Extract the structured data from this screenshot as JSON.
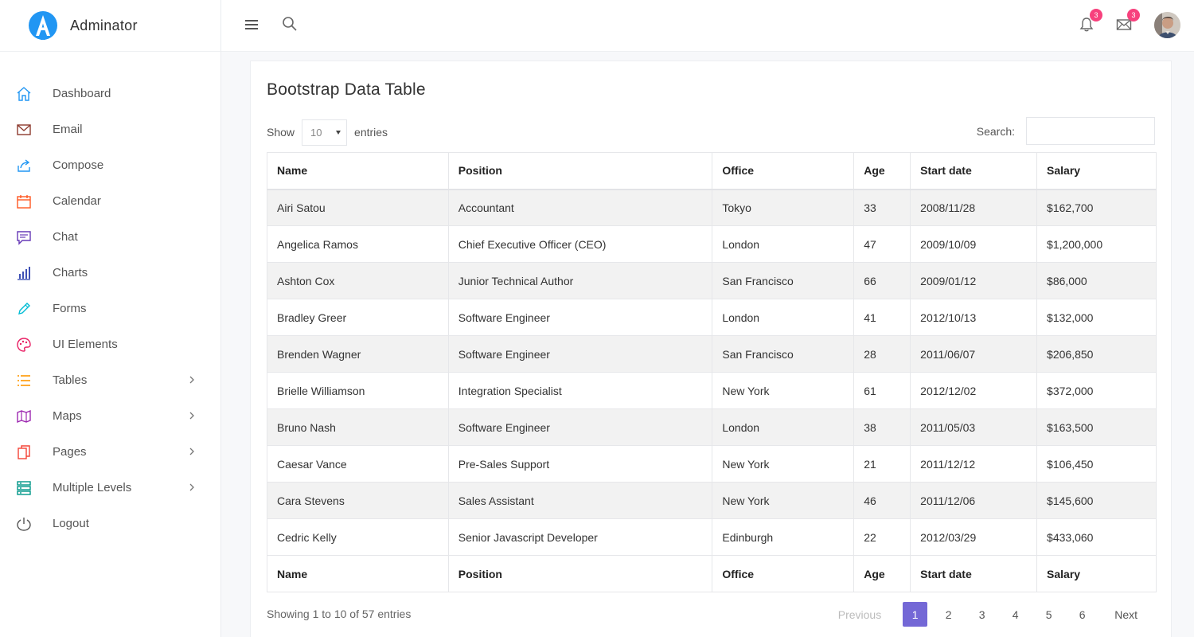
{
  "brand": {
    "name": "Adminator"
  },
  "sidebar": {
    "items": [
      {
        "label": "Dashboard",
        "icon": "home-icon",
        "color": "#2196f3",
        "chevron": false
      },
      {
        "label": "Email",
        "icon": "mail-icon",
        "color": "#8d3a2e",
        "chevron": false
      },
      {
        "label": "Compose",
        "icon": "share-icon",
        "color": "#2196f3",
        "chevron": false
      },
      {
        "label": "Calendar",
        "icon": "calendar-icon",
        "color": "#ff5722",
        "chevron": false
      },
      {
        "label": "Chat",
        "icon": "chat-icon",
        "color": "#673ab7",
        "chevron": false
      },
      {
        "label": "Charts",
        "icon": "bar-chart-icon",
        "color": "#3f51b5",
        "chevron": false
      },
      {
        "label": "Forms",
        "icon": "pencil-icon",
        "color": "#00bcd4",
        "chevron": false
      },
      {
        "label": "UI Elements",
        "icon": "palette-icon",
        "color": "#e91e63",
        "chevron": false
      },
      {
        "label": "Tables",
        "icon": "list-icon",
        "color": "#ff9800",
        "chevron": true
      },
      {
        "label": "Maps",
        "icon": "map-icon",
        "color": "#9c27b0",
        "chevron": true
      },
      {
        "label": "Pages",
        "icon": "files-icon",
        "color": "#f44336",
        "chevron": true
      },
      {
        "label": "Multiple Levels",
        "icon": "layers-icon",
        "color": "#009688",
        "chevron": true
      },
      {
        "label": "Logout",
        "icon": "power-icon",
        "color": "#555555",
        "chevron": false
      }
    ]
  },
  "header": {
    "notifications_count": "3",
    "messages_count": "3",
    "badge_color": "#f7417d"
  },
  "card": {
    "title": "Bootstrap Data Table",
    "show_label": "Show",
    "entries_value": "10",
    "entries_label": "entries",
    "search_label": "Search:",
    "search_value": ""
  },
  "table": {
    "columns": [
      "Name",
      "Position",
      "Office",
      "Age",
      "Start date",
      "Salary"
    ],
    "rows": [
      [
        "Airi Satou",
        "Accountant",
        "Tokyo",
        "33",
        "2008/11/28",
        "$162,700"
      ],
      [
        "Angelica Ramos",
        "Chief Executive Officer (CEO)",
        "London",
        "47",
        "2009/10/09",
        "$1,200,000"
      ],
      [
        "Ashton Cox",
        "Junior Technical Author",
        "San Francisco",
        "66",
        "2009/01/12",
        "$86,000"
      ],
      [
        "Bradley Greer",
        "Software Engineer",
        "London",
        "41",
        "2012/10/13",
        "$132,000"
      ],
      [
        "Brenden Wagner",
        "Software Engineer",
        "San Francisco",
        "28",
        "2011/06/07",
        "$206,850"
      ],
      [
        "Brielle Williamson",
        "Integration Specialist",
        "New York",
        "61",
        "2012/12/02",
        "$372,000"
      ],
      [
        "Bruno Nash",
        "Software Engineer",
        "London",
        "38",
        "2011/05/03",
        "$163,500"
      ],
      [
        "Caesar Vance",
        "Pre-Sales Support",
        "New York",
        "21",
        "2011/12/12",
        "$106,450"
      ],
      [
        "Cara Stevens",
        "Sales Assistant",
        "New York",
        "46",
        "2011/12/06",
        "$145,600"
      ],
      [
        "Cedric Kelly",
        "Senior Javascript Developer",
        "Edinburgh",
        "22",
        "2012/03/29",
        "$433,060"
      ]
    ]
  },
  "footer": {
    "info": "Showing 1 to 10 of 57 entries",
    "previous": "Previous",
    "next": "Next",
    "pages": [
      "1",
      "2",
      "3",
      "4",
      "5",
      "6"
    ],
    "active_page": "1",
    "active_color": "#7468d6"
  }
}
